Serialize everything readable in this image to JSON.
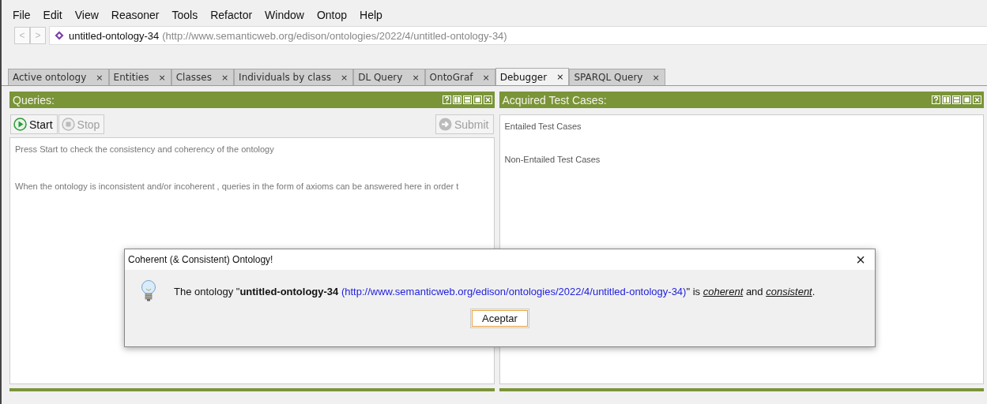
{
  "menu": [
    "File",
    "Edit",
    "View",
    "Reasoner",
    "Tools",
    "Refactor",
    "Window",
    "Ontop",
    "Help"
  ],
  "address": {
    "back": "<",
    "forward": ">",
    "ontology": "untitled-ontology-34",
    "iri": "(http://www.semanticweb.org/edison/ontologies/2022/4/untitled-ontology-34)"
  },
  "tabs": [
    {
      "label": "Active ontology",
      "selected": false
    },
    {
      "label": "Entities",
      "selected": false
    },
    {
      "label": "Classes",
      "selected": false
    },
    {
      "label": "Individuals by class",
      "selected": false
    },
    {
      "label": "DL Query",
      "selected": false
    },
    {
      "label": "OntoGraf",
      "selected": false
    },
    {
      "label": "Debugger",
      "selected": true
    },
    {
      "label": "SPARQL Query",
      "selected": false
    }
  ],
  "close_mark": "×",
  "queries": {
    "title": "Queries:",
    "buttons": [
      {
        "label": "Start",
        "kind": "play",
        "disabled": false
      },
      {
        "label": "Stop",
        "kind": "stop",
        "disabled": true
      }
    ],
    "submit": {
      "label": "Submit",
      "disabled": true
    },
    "lines": [
      "Press Start to check the consistency and coherency of the ontology",
      "When the ontology is inconsistent and/or incoherent , queries in the form of axioms can be answered here in order t"
    ]
  },
  "test_cases": {
    "title": "Acquired Test Cases:",
    "sections": [
      "Entailed Test Cases",
      "Non-Entailed Test Cases"
    ]
  },
  "dialog": {
    "title": "Coherent (& Consistent) Ontology!",
    "close": "×",
    "message": [
      {
        "kind": "text",
        "text": "The ontology \""
      },
      {
        "kind": "bold",
        "text": "untitled-ontology-34"
      },
      {
        "kind": "link",
        "text": "(http://www.semanticweb.org/edison/ontologies/2022/4/untitled-ontology-34)"
      },
      {
        "kind": "text",
        "text": "\" is "
      },
      {
        "kind": "term",
        "text": "coherent"
      },
      {
        "kind": "text",
        "text": " and "
      },
      {
        "kind": "term",
        "text": "consistent"
      },
      {
        "kind": "text",
        "text": "."
      }
    ],
    "button": "Aceptar"
  }
}
